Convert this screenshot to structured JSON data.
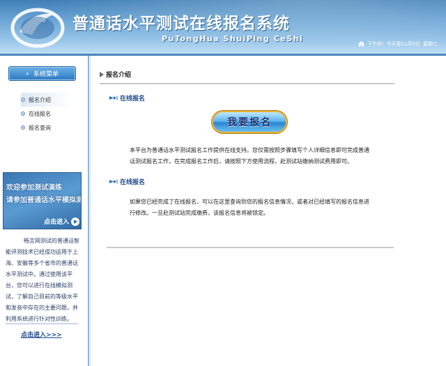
{
  "header": {
    "title": "普通话水平测试在线报名系统",
    "subtitle": "PuTongHua ShuiPing CeShi",
    "greeting": "下午好!",
    "date_text": "今天是11月9日",
    "weekday": "星期三"
  },
  "sidebar": {
    "menu_title": "系统菜单",
    "items": [
      {
        "label": "报名介绍"
      },
      {
        "label": "在线报名"
      },
      {
        "label": "报名查询"
      }
    ],
    "promo": {
      "line1": "欢迎参加测试演练",
      "line2": "请参加普通话水平模拟测试",
      "enter_label": "点击进入"
    },
    "description": "畅言网测试的普通话智能评测技术已经成功运用于上海、安徽等多个省市的普通话水平测试中。通过使用该平台，您可以进行在线模拟测试，了解自己目前的等级水平和发音中存在的主要问题，并利用系统进行针对性训练。",
    "more_link": "点击进入>>>"
  },
  "main": {
    "section_title": "报名介绍",
    "block1": {
      "title": "在线报名",
      "button_label": "我要报名",
      "text": "本平台为普通话水平测试报名工作提供在线支持。您仅需按照步骤填写个人详细信息即可完成普通话测试报名工作，在完成报名工作后，请按照下方使用流程，赴测试站缴纳测试费用即可。"
    },
    "block2": {
      "title": "在线报名",
      "text": "如果您已经完成了在线报名，可以在这里查询到您的报名信息情况，或者对已经填写的报名信息进行修改。一旦赴测试站完成缴费，该报名信息将被锁定。"
    }
  },
  "icons": {
    "home": "home-icon",
    "bullet": "bullet-icon",
    "section_arrow": "triangle-right-icon",
    "sub_arrow": "arrow-right-icon",
    "promo_arrow": "arrow-circle-icon"
  },
  "colors": {
    "header_top": "#3f7fb6",
    "header_bottom": "#c9e2f5",
    "accent_blue": "#1f4a8a",
    "button_border": "#e8b43a"
  }
}
